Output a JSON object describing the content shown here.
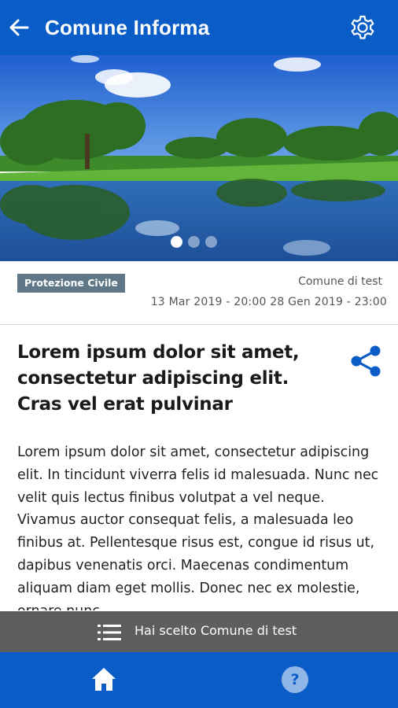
{
  "header": {
    "title": "Comune Informa",
    "back_icon": "arrow-left-icon",
    "settings_icon": "gear-icon"
  },
  "carousel": {
    "slides_count": 3,
    "active_index": 0
  },
  "article": {
    "category": "Protezione Civile",
    "comune": "Comune di test",
    "dates": "13 Mar 2019 - 20:00 28 Gen 2019 - 23:00",
    "title": "Lorem ipsum dolor sit amet, consectetur adipiscing elit. Cras vel erat pulvinar",
    "body": "Lorem ipsum dolor sit amet, consectetur adipiscing elit. In tincidunt viverra felis id malesuada. Nunc nec velit quis lectus finibus volutpat a vel neque. Vivamus auctor consequat felis, a malesuada leo finibus at. Pellentesque risus est, congue id risus ut, dapibus venenatis orci. Maecenas condimentum aliquam diam eget mollis. Donec nec ex molestie, ornare nunc"
  },
  "chooser": {
    "label": "Hai scelto Comune di test"
  },
  "bottom_nav": {
    "home_icon": "home-icon",
    "help_label": "?"
  },
  "colors": {
    "primary": "#0a5cc7",
    "tag_bg": "#5f7787",
    "chooser_bg": "#5c5e60"
  }
}
